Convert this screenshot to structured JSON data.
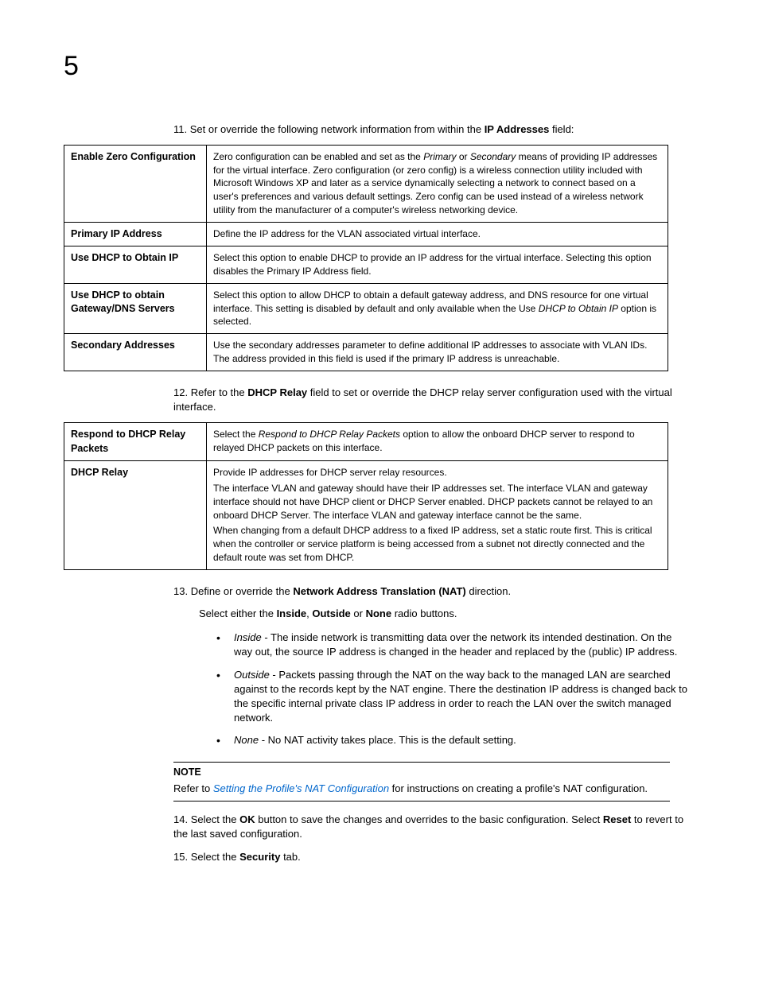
{
  "chapter": "5",
  "step11": {
    "num": "11.",
    "prefix": "Set or override the following network information from within the ",
    "bold": "IP Addresses",
    "suffix": " field:"
  },
  "table1": [
    {
      "term": "Enable Zero Configuration",
      "desc_pre": "Zero configuration can be enabled and set as the ",
      "i1": "Primary",
      "mid1": " or ",
      "i2": "Secondary",
      "desc_post": " means of providing IP addresses for the virtual interface. Zero configuration (or zero config) is a wireless connection utility included with Microsoft Windows XP and later as a service dynamically selecting a network to connect based on a user's preferences and various default settings. Zero config can be used instead of a wireless network utility from the manufacturer of a computer's wireless networking device."
    },
    {
      "term": "Primary IP Address",
      "desc": "Define the IP address for the VLAN associated virtual interface."
    },
    {
      "term": "Use DHCP to Obtain IP",
      "desc": "Select this option to enable DHCP to provide an IP address for the virtual interface. Selecting this option disables the Primary IP Address field."
    },
    {
      "term": "Use DHCP to obtain Gateway/DNS Servers",
      "desc_pre": "Select this option to allow DHCP to obtain a default gateway address, and DNS resource for one virtual interface. This setting is disabled by default and only available when the Use ",
      "i1": "DHCP to Obtain IP",
      "desc_post": " option is selected."
    },
    {
      "term": "Secondary Addresses",
      "desc": "Use the secondary addresses parameter to define additional IP addresses to associate with VLAN IDs. The address provided in this field is used if the primary IP address is unreachable."
    }
  ],
  "step12": {
    "num": "12.",
    "prefix": "Refer to the ",
    "bold": "DHCP Relay",
    "suffix": " field to set or override the DHCP relay server configuration used with the virtual interface."
  },
  "table2": [
    {
      "term": "Respond to DHCP Relay Packets",
      "desc_pre": "Select the ",
      "i1": "Respond to DHCP Relay Packets",
      "desc_post": " option to allow the onboard DHCP server to respond to relayed DHCP packets on this interface."
    },
    {
      "term": "DHCP Relay",
      "p1": "Provide IP addresses for DHCP server relay resources.",
      "p2": "The interface VLAN and gateway should have their IP addresses set. The interface VLAN and gateway interface should not have DHCP client or DHCP Server enabled. DHCP packets cannot be relayed to an onboard DHCP Server. The interface VLAN and gateway interface cannot be the same.",
      "p3": "When changing from a default DHCP address to a fixed IP address, set a static route first. This is critical when the controller or service platform is being accessed from a subnet not directly connected and the default route was set from DHCP."
    }
  ],
  "step13": {
    "num": "13.",
    "prefix": "Define or override the ",
    "bold": "Network Address Translation (NAT)",
    "suffix": " direction."
  },
  "step13sub": {
    "pre": "Select either the ",
    "b1": "Inside",
    "m1": ", ",
    "b2": "Outside",
    "m2": " or ",
    "b3": "None",
    "post": " radio buttons."
  },
  "bullets": [
    {
      "label": "Inside",
      "text": " - The inside network is transmitting data over the network its intended destination. On the way out, the source IP address is changed in the header and replaced by the (public) IP address."
    },
    {
      "label": "Outside",
      "text": " - Packets passing through the NAT on the way back to the managed LAN are searched against to the records kept by the NAT engine. There the destination IP address is changed back to the specific internal private class IP address in order to reach the LAN over the switch managed network."
    },
    {
      "label": "None",
      "text": " - No NAT activity takes place. This is the default setting."
    }
  ],
  "note": {
    "title": "NOTE",
    "pre": "Refer to ",
    "link": "Setting the Profile's NAT Configuration",
    "post": " for instructions on creating a profile's NAT configuration."
  },
  "step14": {
    "num": "14.",
    "pre": "Select the ",
    "b1": "OK",
    "mid": " button to save the changes and overrides to the basic configuration. Select ",
    "b2": "Reset",
    "post": " to revert to the last saved configuration."
  },
  "step15": {
    "num": "15.",
    "pre": "Select the ",
    "b1": "Security",
    "post": " tab."
  }
}
